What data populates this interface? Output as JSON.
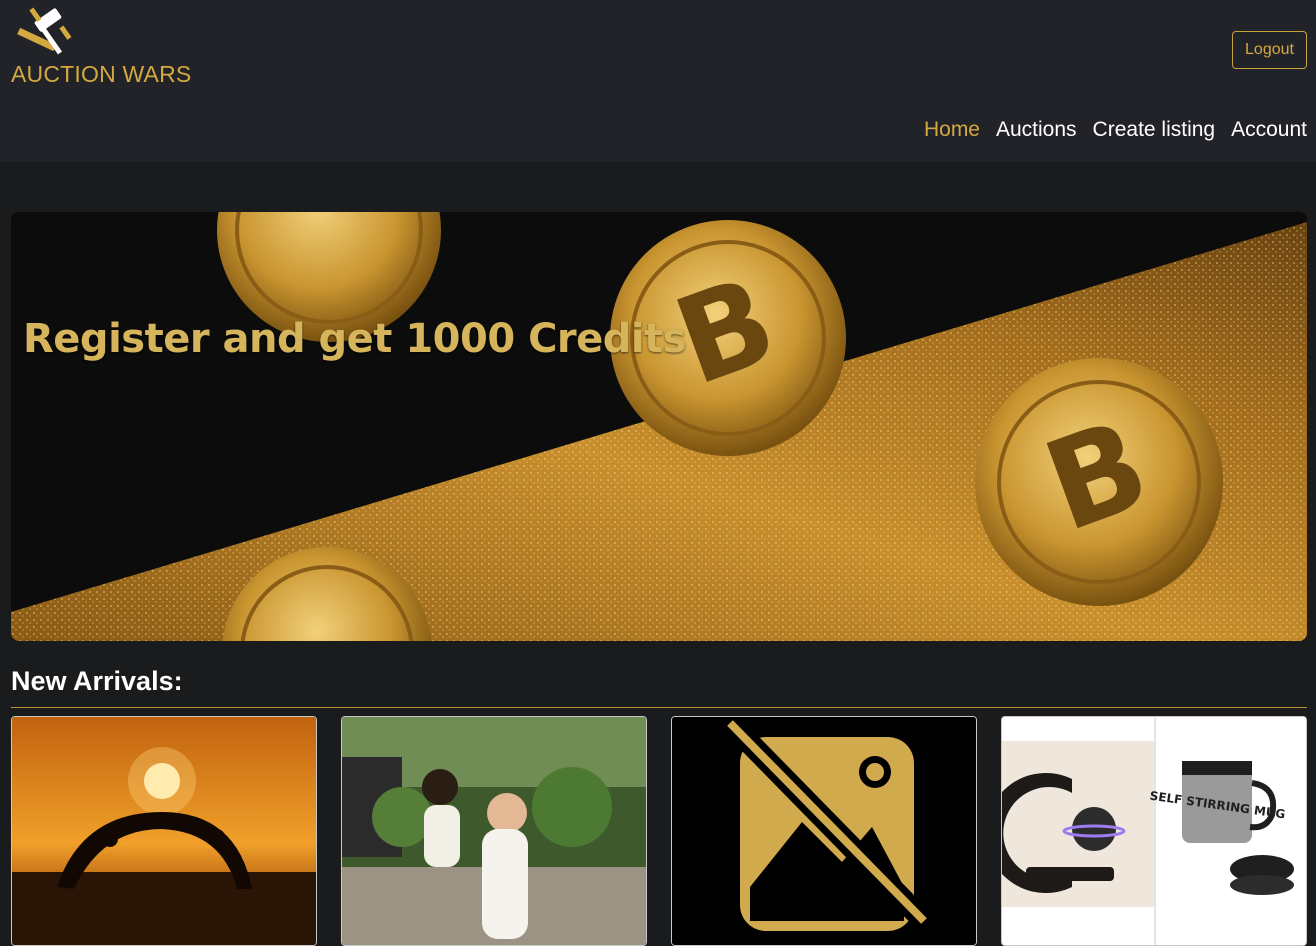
{
  "brand": {
    "name": "AUCTION WARS",
    "logo_icon": "gavel-icon",
    "accent": "#d4a93f"
  },
  "header": {
    "logout_label": "Logout"
  },
  "nav": {
    "items": [
      {
        "label": "Home",
        "active": true
      },
      {
        "label": "Auctions",
        "active": false
      },
      {
        "label": "Create listing",
        "active": false
      },
      {
        "label": "Account",
        "active": false
      }
    ]
  },
  "hero": {
    "headline": "Register and get 1000 Credits"
  },
  "new_arrivals": {
    "title": "New Arrivals:",
    "cards": [
      {
        "image": "sunset-yoga-photo"
      },
      {
        "image": "mother-and-baby-garden-photo"
      },
      {
        "image": "no-image-placeholder-icon"
      },
      {
        "image": "levitating-globe-and-self-stirring-mug-photo",
        "mug_text": "SELF STIRRING MUG"
      }
    ]
  }
}
